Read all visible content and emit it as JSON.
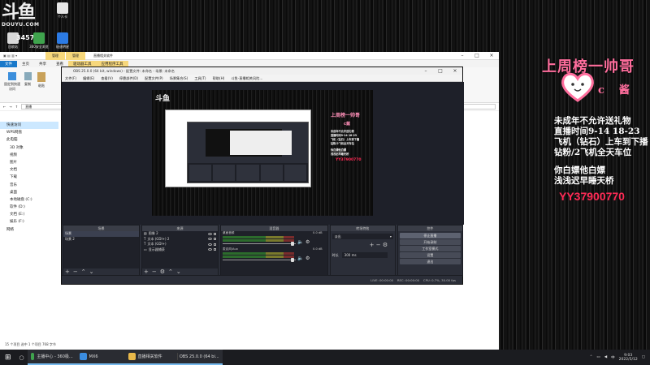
{
  "desktop": {
    "logo_big": "斗鱼",
    "logo_sub": "DOUYU.COM",
    "icons": [
      {
        "label": "回收站",
        "color": "#d9d9d9"
      },
      {
        "label": "360安全浏览",
        "color": "#3fa34d"
      },
      {
        "label": "极速明星",
        "color": "#2c7be5"
      },
      {
        "label": "个人卡",
        "color": "#e6e6e6"
      }
    ],
    "number_label": "3457"
  },
  "explorer": {
    "title": "直播相关软件",
    "ribbon_tabs": [
      "文件",
      "主页",
      "共享",
      "查看",
      "管理",
      "管理"
    ],
    "ribbon_upper_tabs": [
      "管理",
      "管理"
    ],
    "ribbon_lower_extra": [
      "驱动器工具",
      "应用程序工具"
    ],
    "ribbon_buttons": [
      "固定到快速访问",
      "复制",
      "粘贴"
    ],
    "address": "直播",
    "nav": [
      "快速访问",
      "WPS网盘",
      "此电脑",
      "3D 对象",
      "视频",
      "图片",
      "文档",
      "下载",
      "音乐",
      "桌面",
      "本地磁盘 (C:)",
      "软件 (D:)",
      "文档 (E:)",
      "娱乐 (F:)",
      "网络"
    ],
    "status": "15 个项目   选中 1 个项目  768 字节"
  },
  "obs": {
    "title": "OBS 25.0.0 (64 bit, windows) - 配置文件: 未命名 - 场景: 未命名",
    "menu": [
      "文件(F)",
      "编辑(E)",
      "查看(V)",
      "停靠部件(D)",
      "配置文件(P)",
      "场景集合(S)",
      "工具(T)",
      "帮助(H)",
      "斗鱼-直播相关风险..."
    ],
    "docks": {
      "scenes": {
        "header": "场景",
        "items": [
          "场景",
          "场景 2"
        ]
      },
      "sources": {
        "header": "来源",
        "items": [
          "图像 2",
          "文本 (GDI+) 2",
          "文本 (GDI+)",
          "显示器捕获"
        ]
      },
      "mixer": {
        "header": "混音器",
        "tracks": [
          {
            "name": "桌面音频",
            "db": "0.0 dB"
          },
          {
            "name": "麦克风/Aux",
            "db": "0.0 dB"
          }
        ]
      },
      "transitions": {
        "header": "转场特效",
        "type": "淡出",
        "duration_label": "时长",
        "duration": "300 ms"
      },
      "controls": {
        "header": "控件",
        "buttons": [
          "停止直播",
          "开始录制",
          "工作室模式",
          "设置",
          "退出"
        ]
      }
    },
    "status": "LIVE: 00:00:00    REC: 00:00:00    CPU: 0.7%, 30.00 fps"
  },
  "overlay": {
    "title": "上周榜一帅哥",
    "name": "c酱",
    "lines": [
      "未成年不允许送礼物",
      "直播时间9-14 18-23",
      "飞机（钻石）上车到下播",
      "钻粉/2飞机全天车位",
      "你白嫖他白嫖",
      "浅浅迟早睡天桥"
    ],
    "qq": "YY37900770",
    "pink": "#ff6e9d"
  },
  "taskbar": {
    "items": [
      {
        "label": "主播中心 - 360极...",
        "color": "#3fa34d"
      },
      {
        "label": "MX6",
        "color": "#3b8de0"
      },
      {
        "label": "直播相关软件",
        "color": "#e8b84a"
      },
      {
        "label": "OBS 25.0.0 (64 bi...",
        "color": "#444"
      }
    ],
    "time": "9:03",
    "date": "2022/5/12"
  }
}
